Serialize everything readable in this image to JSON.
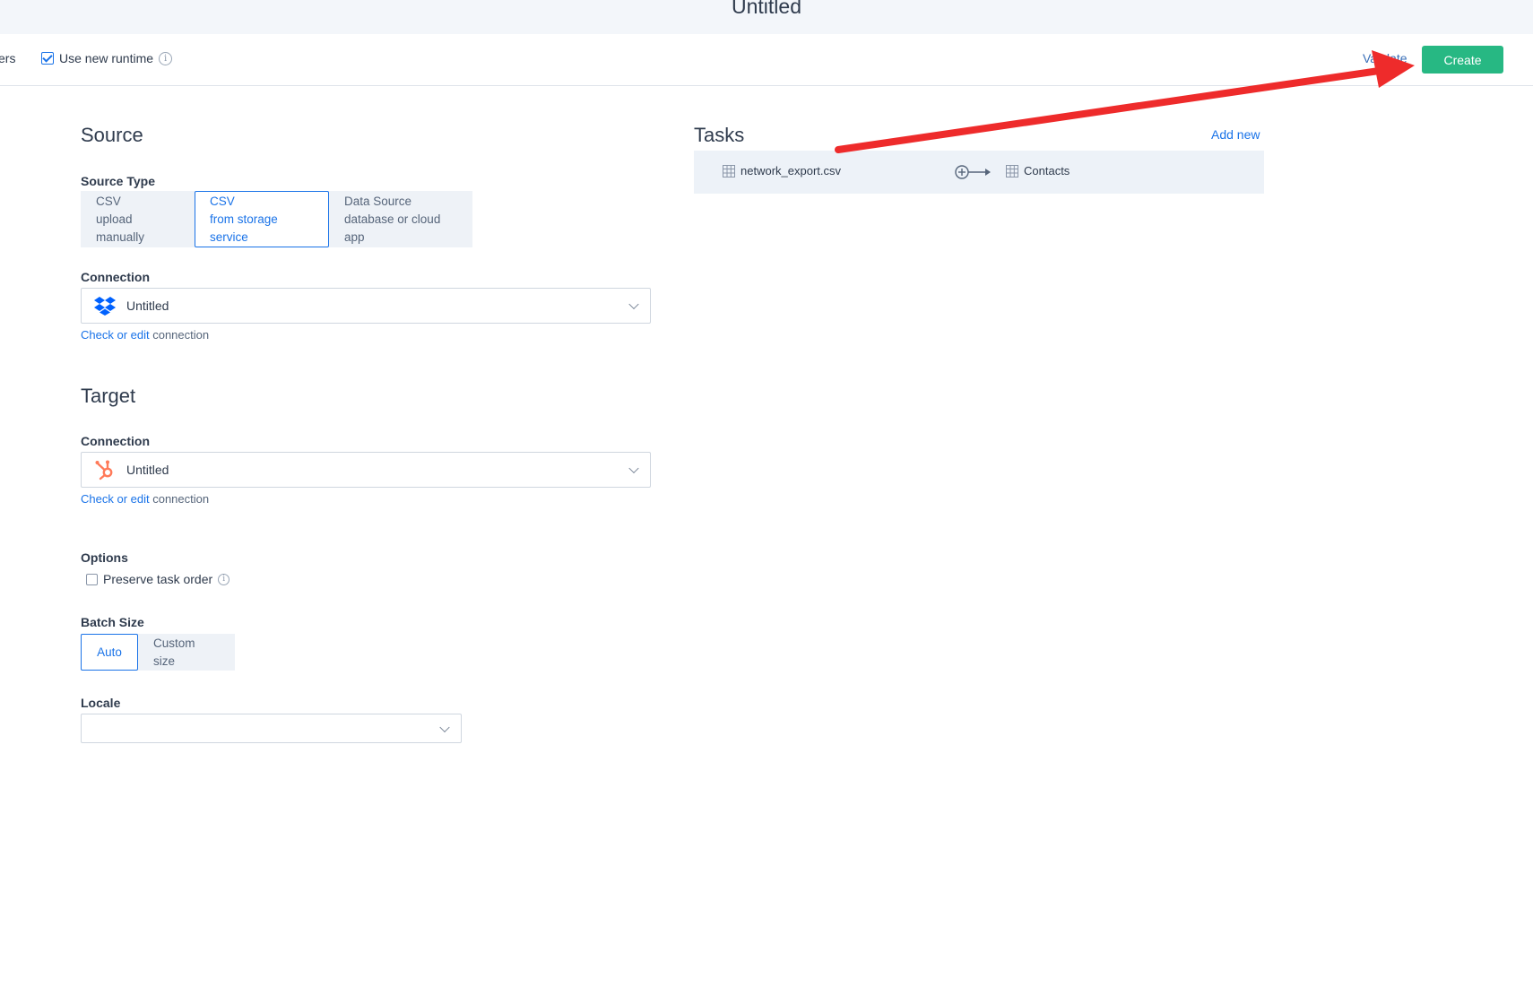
{
  "header": {
    "title": "Untitled"
  },
  "toolbar": {
    "partial_label": "ers",
    "use_new_runtime_label": "Use new runtime",
    "use_new_runtime_checked": true,
    "validate_label": "Validate",
    "create_label": "Create",
    "create_color": "#27b883"
  },
  "source": {
    "heading": "Source",
    "source_type_label": "Source Type",
    "source_types": [
      {
        "title": "CSV",
        "subtitle": "upload manually",
        "active": false
      },
      {
        "title": "CSV",
        "subtitle": "from storage service",
        "active": true
      },
      {
        "title": "Data Source",
        "subtitle": "database or cloud app",
        "active": false
      }
    ],
    "connection_label": "Connection",
    "connection_value": "Untitled",
    "connection_icon": "dropbox-icon",
    "check_link": "Check or edit",
    "check_suffix": "connection"
  },
  "target": {
    "heading": "Target",
    "connection_label": "Connection",
    "connection_value": "Untitled",
    "connection_icon": "hubspot-icon",
    "check_link": "Check or edit",
    "check_suffix": "connection"
  },
  "options": {
    "label": "Options",
    "preserve_task_order_label": "Preserve task order",
    "preserve_task_order_checked": false
  },
  "batch_size": {
    "label": "Batch Size",
    "options": [
      {
        "label": "Auto",
        "active": true
      },
      {
        "label": "Custom size",
        "active": false
      }
    ]
  },
  "locale": {
    "label": "Locale",
    "value": ""
  },
  "tasks": {
    "heading": "Tasks",
    "add_new_label": "Add new",
    "items": [
      {
        "source": "network_export.csv",
        "target": "Contacts"
      }
    ]
  },
  "accent_color": "#1a73e8",
  "annotation_arrow_color": "#ee2b2b"
}
